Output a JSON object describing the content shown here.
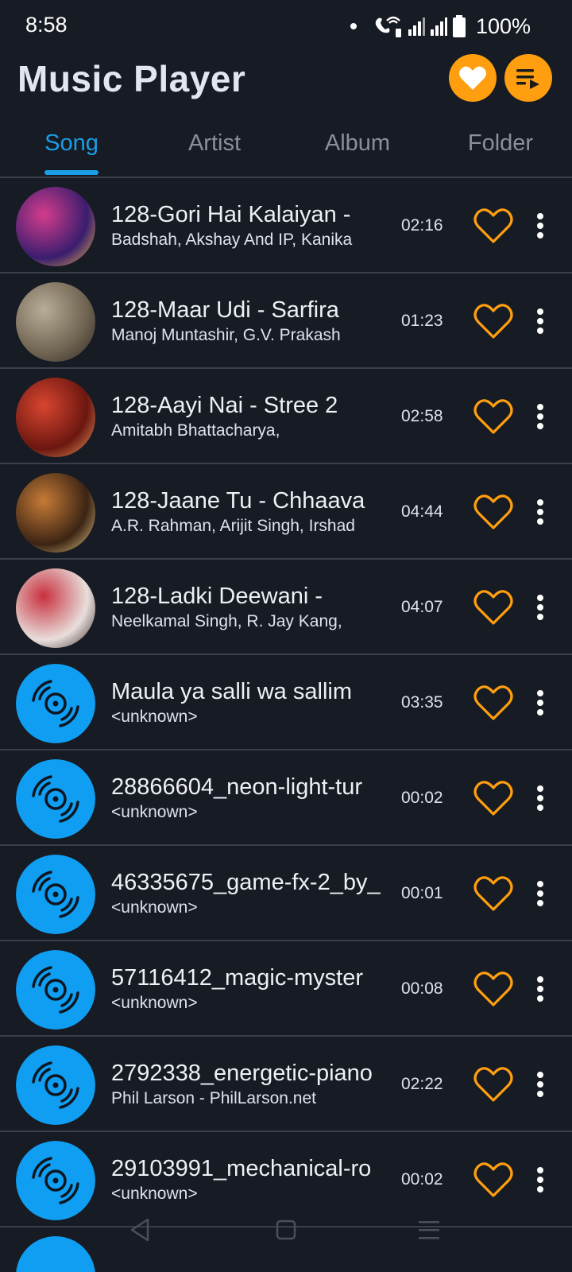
{
  "status": {
    "time": "8:58",
    "battery": "100%"
  },
  "app": {
    "title": "Music Player"
  },
  "tabs": [
    {
      "label": "Song",
      "active": true
    },
    {
      "label": "Artist",
      "active": false
    },
    {
      "label": "Album",
      "active": false
    },
    {
      "label": "Folder",
      "active": false
    }
  ],
  "songs": [
    {
      "title": "128-Gori Hai Kalaiyan -",
      "artist": "Badshah, Akshay And IP, Kanika",
      "duration": "02:16",
      "art": "album-art"
    },
    {
      "title": "128-Maar Udi - Sarfira",
      "artist": "Manoj Muntashir, G.V. Prakash",
      "duration": "01:23",
      "art": "album-art"
    },
    {
      "title": "128-Aayi Nai - Stree 2",
      "artist": "Amitabh Bhattacharya,",
      "duration": "02:58",
      "art": "album-art"
    },
    {
      "title": "128-Jaane Tu - Chhaava",
      "artist": "A.R. Rahman, Arijit Singh, Irshad",
      "duration": "04:44",
      "art": "album-art"
    },
    {
      "title": "128-Ladki Deewani -",
      "artist": "Neelkamal Singh, R. Jay Kang,",
      "duration": "04:07",
      "art": "album-art"
    },
    {
      "title": "Maula ya salli wa sallim",
      "artist": "<unknown>",
      "duration": "03:35",
      "art": "disc-icon"
    },
    {
      "title": "28866604_neon-light-tur",
      "artist": "<unknown>",
      "duration": "00:02",
      "art": "disc-icon"
    },
    {
      "title": "46335675_game-fx-2_by_",
      "artist": "<unknown>",
      "duration": "00:01",
      "art": "disc-icon"
    },
    {
      "title": "57116412_magic-myster",
      "artist": "<unknown>",
      "duration": "00:08",
      "art": "disc-icon"
    },
    {
      "title": "2792338_energetic-piano",
      "artist": "Phil Larson - PhilLarson.net",
      "duration": "02:22",
      "art": "disc-icon"
    },
    {
      "title": "29103991_mechanical-ro",
      "artist": "<unknown>",
      "duration": "00:02",
      "art": "disc-icon"
    }
  ],
  "colors": {
    "background": "#171b23",
    "accent": "#1a9de8",
    "favorite": "#ff9f0f",
    "divider": "#3a3f4a"
  },
  "icons": {
    "header": [
      "heart-icon",
      "playlist-icon"
    ],
    "row": [
      "heart-outline-icon",
      "more-vert-icon"
    ],
    "nav": [
      "back-icon",
      "home-icon",
      "recents-icon"
    ]
  }
}
